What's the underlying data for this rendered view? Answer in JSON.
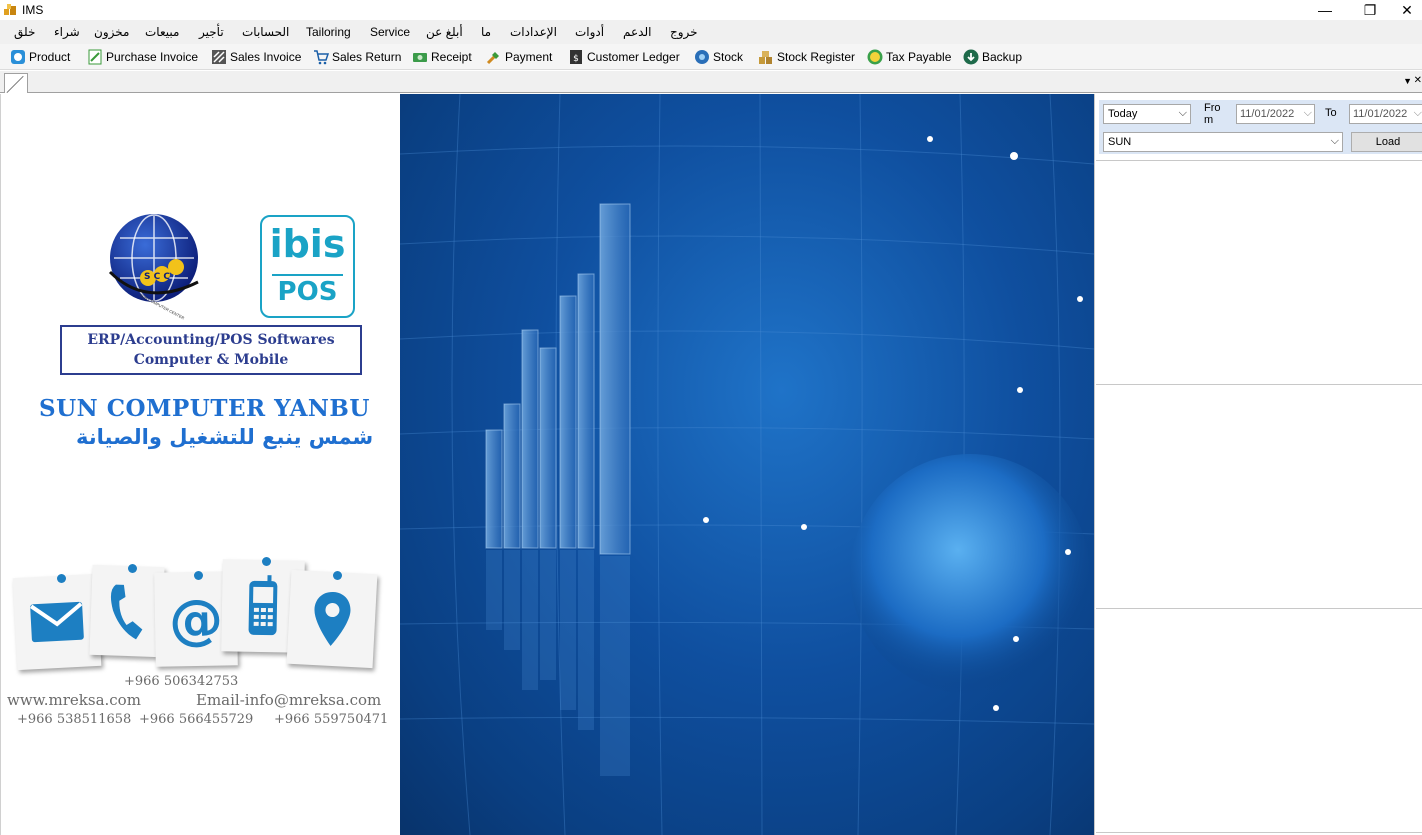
{
  "window": {
    "title": "IMS",
    "minimize": "—",
    "restore": "❐",
    "close": "✕"
  },
  "menu": [
    {
      "label": "خلق"
    },
    {
      "label": "شراء"
    },
    {
      "label": "مخزون"
    },
    {
      "label": "مبيعات"
    },
    {
      "label": "تأجير"
    },
    {
      "label": "الحسابات"
    },
    {
      "label": "Tailoring"
    },
    {
      "label": "Service"
    },
    {
      "label": "أبلغ عن"
    },
    {
      "label": "ما"
    },
    {
      "label": "الإعدادات"
    },
    {
      "label": "أدوات"
    },
    {
      "label": "الدعم"
    },
    {
      "label": "خروج"
    }
  ],
  "toolbar": [
    {
      "label": "Product",
      "icon": "product-icon"
    },
    {
      "label": "Purchase Invoice",
      "icon": "purchase-invoice-icon"
    },
    {
      "label": "Sales Invoice",
      "icon": "sales-invoice-icon"
    },
    {
      "label": "Sales Return",
      "icon": "cart-icon"
    },
    {
      "label": "Receipt",
      "icon": "receipt-icon"
    },
    {
      "label": "Payment",
      "icon": "payment-icon"
    },
    {
      "label": "Customer Ledger",
      "icon": "ledger-icon"
    },
    {
      "label": "Stock",
      "icon": "stock-icon"
    },
    {
      "label": "Stock Register",
      "icon": "stock-register-icon"
    },
    {
      "label": "Tax Payable",
      "icon": "tax-icon"
    },
    {
      "label": "Backup",
      "icon": "backup-icon"
    }
  ],
  "filter": {
    "period": "Today",
    "from_label": "From",
    "from_date": "11/01/2022",
    "to_label": "To",
    "to_date": "11/01/2022",
    "branch": "SUN",
    "load_label": "Load"
  },
  "promo": {
    "erp_line1": "ERP/Accounting/POS Softwares",
    "erp_line2": "Computer & Mobile",
    "company_en": "SUN COMPUTER YANBU",
    "company_ar": "شمس ينبع للتشغيل والصيانة",
    "ibis": "ibis",
    "pos": "POS",
    "scc": "S C C",
    "scc_caption": "SUN COMPUTER CENTER",
    "phone_top": "+966 506342753",
    "website": "www.mreksa.com",
    "email": "Email-info@mreksa.com",
    "phone1": "+966 538511658",
    "phone2": "+966 566455729",
    "phone3": "+966 559750471"
  },
  "colors": {
    "accent": "#1f6fd0",
    "frame_border": "#2c3d8f",
    "hero_blue": "#0f4f9f",
    "filter_bg": "#dbe6f5"
  }
}
